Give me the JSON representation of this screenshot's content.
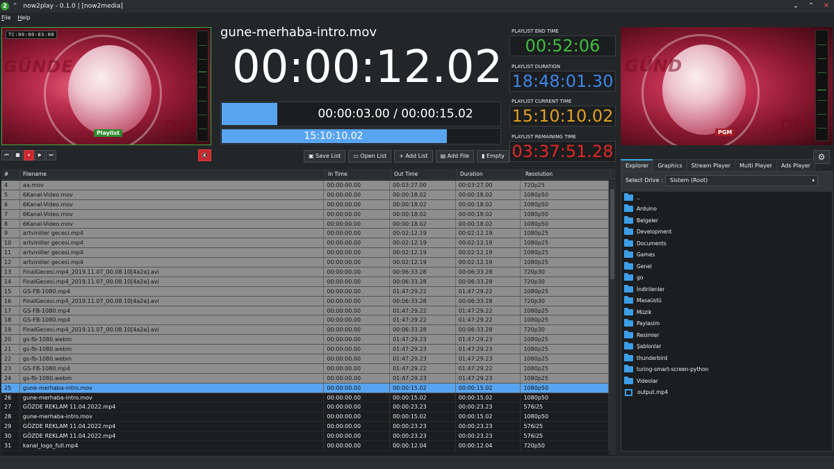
{
  "window": {
    "title": "now2play - 0.1.0 | [now2media]",
    "logo": "2"
  },
  "menu": {
    "file": "File",
    "help": "Help"
  },
  "preview_left": {
    "timecode": "TC:00:00:03:00",
    "tag": "Playlist",
    "overlay_word": "GÜNDE",
    "overlay_word2": "DEM"
  },
  "preview_right": {
    "tag": "PGM",
    "overlay_word": "GÜND",
    "overlay_word2": "DEM"
  },
  "transport": {
    "first": "⏮",
    "stop": "■",
    "pause": "⏸",
    "play": "▶",
    "last": "⏭",
    "mute": "🔇"
  },
  "clip": {
    "name": "gune-merhaba-intro.mov",
    "big_clock": "00:00:12.02",
    "progress_text": "00:00:03.00 / 00:00:15.02",
    "progress_fraction": 0.2,
    "time_text": "15:10:10.02",
    "time_fraction": 0.806
  },
  "list_buttons": {
    "save": "Save List",
    "open": "Open List",
    "add_list": "+ Add List",
    "add_file": "Add File",
    "empty": "Empty"
  },
  "playlist_info": [
    {
      "label": "PLAYLIST END TIME",
      "value": "00:52:06",
      "color": "#3fbf3f"
    },
    {
      "label": "PLAYLIST DURATION",
      "value": "18:48:01.30",
      "color": "#3d86e8"
    },
    {
      "label": "PLAYLIST CURRENT TIME",
      "value": "15:10:10.02",
      "color": "#e0a020"
    },
    {
      "label": "PLAYLIST REMAINING TIME",
      "value": "03:37:51.28",
      "color": "#e02828"
    }
  ],
  "settings_icon": "⚙",
  "tabs": [
    "Explorer",
    "Graphics",
    "Stream Player",
    "Multi Player",
    "Ads Player"
  ],
  "explorer": {
    "drive_label": "Select Drive :",
    "drive_value": "Sistem (Root)",
    "items": [
      {
        "name": "..",
        "type": "folder"
      },
      {
        "name": "Arduino",
        "type": "folder"
      },
      {
        "name": "Belgeler",
        "type": "folder"
      },
      {
        "name": "Development",
        "type": "folder"
      },
      {
        "name": "Documents",
        "type": "folder"
      },
      {
        "name": "Games",
        "type": "folder"
      },
      {
        "name": "Genel",
        "type": "folder"
      },
      {
        "name": "go",
        "type": "folder"
      },
      {
        "name": "İndirilenler",
        "type": "folder"
      },
      {
        "name": "Masaüstü",
        "type": "folder"
      },
      {
        "name": "Müzik",
        "type": "folder"
      },
      {
        "name": "Paylasim",
        "type": "folder"
      },
      {
        "name": "Resimler",
        "type": "folder"
      },
      {
        "name": "Şablonlar",
        "type": "folder"
      },
      {
        "name": "thunderbird",
        "type": "folder"
      },
      {
        "name": "turing-smart-screen-python",
        "type": "folder"
      },
      {
        "name": "Videolar",
        "type": "folder"
      },
      {
        "name": "output.mp4",
        "type": "video"
      }
    ]
  },
  "grid": {
    "headers": [
      "#",
      "Filename",
      "In Time",
      "Out Time",
      "Duration",
      "Resolution"
    ],
    "rows": [
      [
        "4",
        "aa.mov",
        "00:00:00.00",
        "00:03:27.00",
        "00:03:27.00",
        "720p25",
        "played"
      ],
      [
        "5",
        "6Kanal-Video.mov",
        "00:00:00.00",
        "00:00:18.02",
        "00:00:18.02",
        "1080p50",
        "played"
      ],
      [
        "6",
        "6Kanal-Video.mov",
        "00:00:00.00",
        "00:00:18.02",
        "00:00:18.02",
        "1080p50",
        "played"
      ],
      [
        "7",
        "6Kanal-Video.mov",
        "00:00:00.00",
        "00:00:18.02",
        "00:00:18.02",
        "1080p50",
        "played"
      ],
      [
        "8",
        "6Kanal-Video.mov",
        "00:00:00.00",
        "00:00:18.02",
        "00:00:18.02",
        "1080p50",
        "played"
      ],
      [
        "9",
        "artvinliler gecesi.mp4",
        "00:00:00.00",
        "00:02:12.19",
        "00:02:12.19",
        "1080p25",
        "played"
      ],
      [
        "10",
        "artvinliler gecesi.mp4",
        "00:00:00.00",
        "00:02:12.19",
        "00:02:12.19",
        "1080p25",
        "played"
      ],
      [
        "11",
        "artvinliler gecesi.mp4",
        "00:00:00.00",
        "00:02:12.19",
        "00:02:12.19",
        "1080p25",
        "played"
      ],
      [
        "12",
        "artvinliler gecesi.mp4",
        "00:00:00.00",
        "00:02:12.19",
        "00:02:12.19",
        "1080p25",
        "played"
      ],
      [
        "13",
        "FinalGecesi.mp4_2019.11.07_00.08.10[4a2a].avi",
        "00:00:00.00",
        "00:06:33.28",
        "00:06:33.28",
        "720p30",
        "played"
      ],
      [
        "14",
        "FinalGecesi.mp4_2019.11.07_00.08.10[4a2a].avi",
        "00:00:00.00",
        "00:06:33.28",
        "00:06:33.28",
        "720p30",
        "played"
      ],
      [
        "15",
        "GS-FB-1080.mp4",
        "00:00:00.00",
        "01:47:29.22",
        "01:47:29.22",
        "1080p25",
        "played"
      ],
      [
        "16",
        "FinalGecesi.mp4_2019.11.07_00.08.10[4a2a].avi",
        "00:00:00.00",
        "00:06:33.28",
        "00:06:33.28",
        "720p30",
        "played"
      ],
      [
        "17",
        "GS-FB-1080.mp4",
        "00:00:00.00",
        "01:47:29.22",
        "01:47:29.22",
        "1080p25",
        "played"
      ],
      [
        "18",
        "GS-FB-1080.mp4",
        "00:00:00.00",
        "01:47:29.22",
        "01:47:29.22",
        "1080p25",
        "played"
      ],
      [
        "19",
        "FinalGecesi.mp4_2019.11.07_00.08.10[4a2a].avi",
        "00:00:00.00",
        "00:06:33.28",
        "00:06:33.28",
        "720p30",
        "played"
      ],
      [
        "20",
        "gs-fb-1080.webm",
        "00:00:00.00",
        "01:47:29.23",
        "01:47:29.23",
        "1080p25",
        "played"
      ],
      [
        "21",
        "gs-fb-1080.webm",
        "00:00:00.00",
        "01:47:29.23",
        "01:47:29.23",
        "1080p25",
        "played"
      ],
      [
        "22",
        "gs-fb-1080.webm",
        "00:00:00.00",
        "01:47:29.23",
        "01:47:29.23",
        "1080p25",
        "played"
      ],
      [
        "23",
        "GS-FB-1080.mp4",
        "00:00:00.00",
        "01:47:29.22",
        "01:47:29.22",
        "1080p25",
        "played"
      ],
      [
        "24",
        "gs-fb-1080.webm",
        "00:00:00.00",
        "01:47:29.23",
        "01:47:29.23",
        "1080p25",
        "played"
      ],
      [
        "25",
        "gune-merhaba-intro.mov",
        "00:00:00.00",
        "00:00:15.02",
        "00:00:15.02",
        "1080p50",
        "cur"
      ],
      [
        "26",
        "gune-merhaba-intro.mov",
        "00:00:00.00",
        "00:00:15.02",
        "00:00:15.02",
        "1080p50",
        "next"
      ],
      [
        "27",
        "GÖZDE REKLAM 11.04.2022.mp4",
        "00:00:00.00",
        "00:00:23.23",
        "00:00:23.23",
        "576i25",
        "next"
      ],
      [
        "28",
        "gune-merhaba-intro.mov",
        "00:00:00.00",
        "00:00:15.02",
        "00:00:15.02",
        "1080p50",
        "next"
      ],
      [
        "29",
        "GÖZDE REKLAM 11.04.2022.mp4",
        "00:00:00.00",
        "00:00:23.23",
        "00:00:23.23",
        "576i25",
        "next"
      ],
      [
        "30",
        "GÖZDE REKLAM 11.04.2022.mp4",
        "00:00:00.00",
        "00:00:23.23",
        "00:00:23.23",
        "576i25",
        "next"
      ],
      [
        "31",
        "kanal_logo_full.mp4",
        "00:00:00.00",
        "00:00:12.04",
        "00:00:12.04",
        "720p50",
        "next"
      ]
    ]
  }
}
